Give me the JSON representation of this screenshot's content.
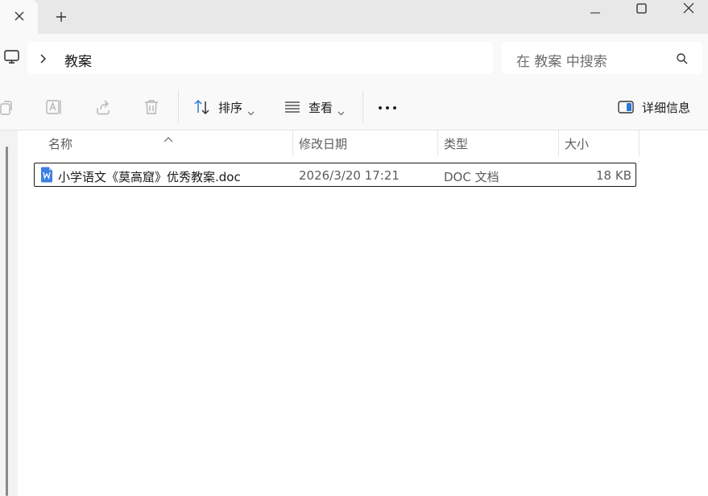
{
  "titlebar": {
    "close_tab_icon": "close-icon",
    "new_tab_icon": "plus-icon",
    "window_controls": [
      "minimize-icon",
      "maximize-icon",
      "close-icon"
    ]
  },
  "address": {
    "breadcrumb": "教案",
    "search_placeholder": "在 教案 中搜索"
  },
  "toolbar": {
    "sort_label": "排序",
    "view_label": "查看",
    "more_label": "•••",
    "details_label": "详细信息"
  },
  "columns": {
    "name": "名称",
    "modified": "修改日期",
    "type": "类型",
    "size": "大小"
  },
  "files": [
    {
      "name": "小学语文《莫高窟》优秀教案.doc",
      "modified": "2026/3/20 17:21",
      "type": "DOC 文档",
      "size": "18 KB",
      "icon": "word-doc-icon"
    }
  ],
  "colors": {
    "accent": "#2b78d6",
    "titlebar_bg": "#e8e8e8",
    "toolbar_bg": "#f9f9f9"
  }
}
